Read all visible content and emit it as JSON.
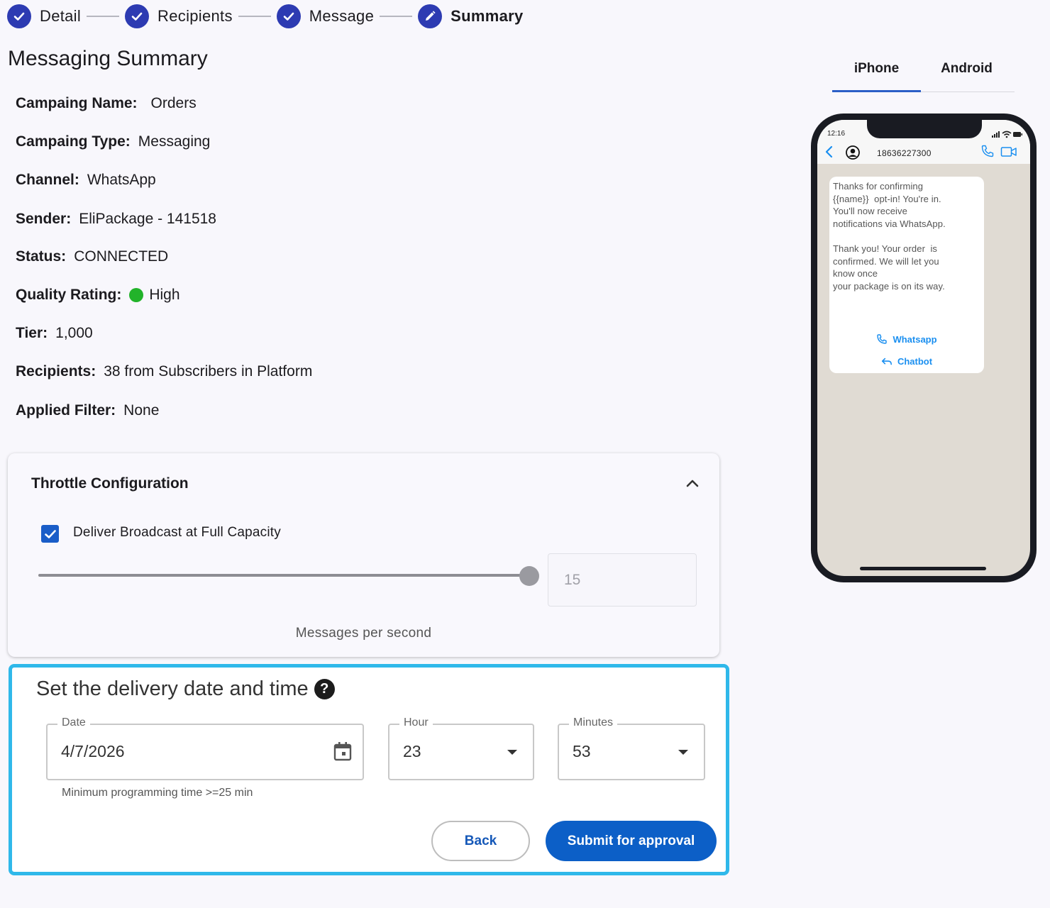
{
  "stepper": {
    "steps": [
      {
        "label": "Detail",
        "state": "done"
      },
      {
        "label": "Recipients",
        "state": "done"
      },
      {
        "label": "Message",
        "state": "done"
      },
      {
        "label": "Summary",
        "state": "current"
      }
    ]
  },
  "page_title": "Messaging Summary",
  "summary": {
    "campaign_name": {
      "label": "Campaing Name:",
      "value": "Orders"
    },
    "campaign_type": {
      "label": "Campaing Type:",
      "value": "Messaging"
    },
    "channel": {
      "label": "Channel:",
      "value": "WhatsApp"
    },
    "sender": {
      "label": "Sender:",
      "value": "EliPackage - 141518"
    },
    "status": {
      "label": "Status:",
      "value": "CONNECTED"
    },
    "quality_rating": {
      "label": "Quality Rating:",
      "value": "High",
      "color": "#22b32a"
    },
    "tier": {
      "label": "Tier:",
      "value": "1,000"
    },
    "recipients": {
      "label": "Recipients:",
      "value": "38 from Subscribers in Platform"
    },
    "applied_filter": {
      "label": "Applied Filter:",
      "value": "None"
    }
  },
  "throttle": {
    "title": "Throttle Configuration",
    "full_capacity_label": "Deliver Broadcast at Full Capacity",
    "full_capacity_checked": true,
    "slider_fraction": 1.0,
    "rate_value": "15",
    "rate_caption": "Messages per second"
  },
  "delivery": {
    "title": "Set the delivery date and time",
    "help_glyph": "?",
    "date": {
      "label": "Date",
      "value": "4/7/2026"
    },
    "hour": {
      "label": "Hour",
      "value": "23"
    },
    "minutes": {
      "label": "Minutes",
      "value": "53"
    },
    "helper": "Minimum programming time >=25 min",
    "back_label": "Back",
    "submit_label": "Submit for approval"
  },
  "preview": {
    "tabs": [
      {
        "label": "iPhone",
        "active": true
      },
      {
        "label": "Android",
        "active": false
      }
    ],
    "phone": {
      "time": "12:16",
      "contact": "18636227300",
      "message": "Thanks for confirming\n{{name}}  opt-in! You're in.\nYou'll now receive\nnotifications via WhatsApp.\n\nThank you! Your order  is\nconfirmed. We will let you\nknow once\nyour package is on its way.",
      "actions": [
        "Whatsapp",
        "Chatbot"
      ]
    }
  },
  "colors": {
    "primary": "#2d3bb2",
    "accent_blue": "#0c5fc7",
    "highlight_border": "#2fb8ea",
    "link_blue": "#1a8ff0"
  }
}
